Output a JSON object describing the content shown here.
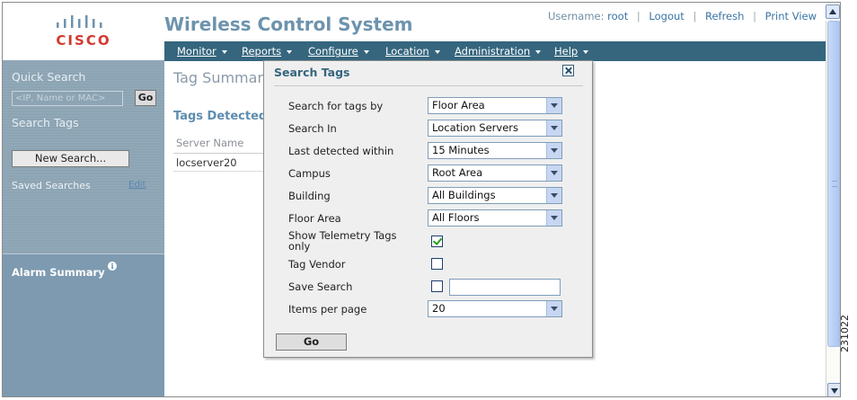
{
  "header": {
    "brand": "CISCO",
    "app_title": "Wireless Control System",
    "username_label": "Username:",
    "username": "root",
    "links": [
      "Logout",
      "Refresh",
      "Print View"
    ]
  },
  "nav": {
    "items": [
      "Monitor",
      "Reports",
      "Configure",
      "Location",
      "Administration",
      "Help"
    ]
  },
  "sidebar": {
    "quick_search_title": "Quick Search",
    "quick_search_placeholder": "<IP, Name or MAC>",
    "go_label": "Go",
    "search_tags_title": "Search Tags",
    "new_search_label": "New Search...",
    "saved_searches_label": "Saved Searches",
    "edit_label": "Edit",
    "alarm_summary_label": "Alarm Summary"
  },
  "main": {
    "title": "Tag Summary",
    "tags_detected_label": "Tags Detected b",
    "column_header": "Server Name",
    "rows": [
      "locserver20"
    ]
  },
  "dialog": {
    "title": "Search Tags",
    "fields": {
      "search_by": {
        "label": "Search for tags by",
        "value": "Floor Area"
      },
      "search_in": {
        "label": "Search In",
        "value": "Location Servers"
      },
      "last_detected": {
        "label": "Last detected within",
        "value": "15 Minutes"
      },
      "campus": {
        "label": "Campus",
        "value": "Root Area"
      },
      "building": {
        "label": "Building",
        "value": "All Buildings"
      },
      "floor_area": {
        "label": "Floor Area",
        "value": "All Floors"
      },
      "telemetry": {
        "label_line1": "Show Telemetry Tags",
        "label_line2": "only",
        "checked": true
      },
      "tag_vendor": {
        "label": "Tag Vendor",
        "checked": false
      },
      "save_search": {
        "label": "Save Search",
        "checked": false,
        "value": ""
      },
      "items_per_page": {
        "label": "Items per page",
        "value": "20"
      }
    },
    "go_label": "Go"
  },
  "figure_id": "231022",
  "colors": {
    "nav_bar": "#35667e",
    "title_blue": "#6d93ad",
    "sidebar": "#8ca4b4",
    "brand_red": "#d13a2e"
  }
}
